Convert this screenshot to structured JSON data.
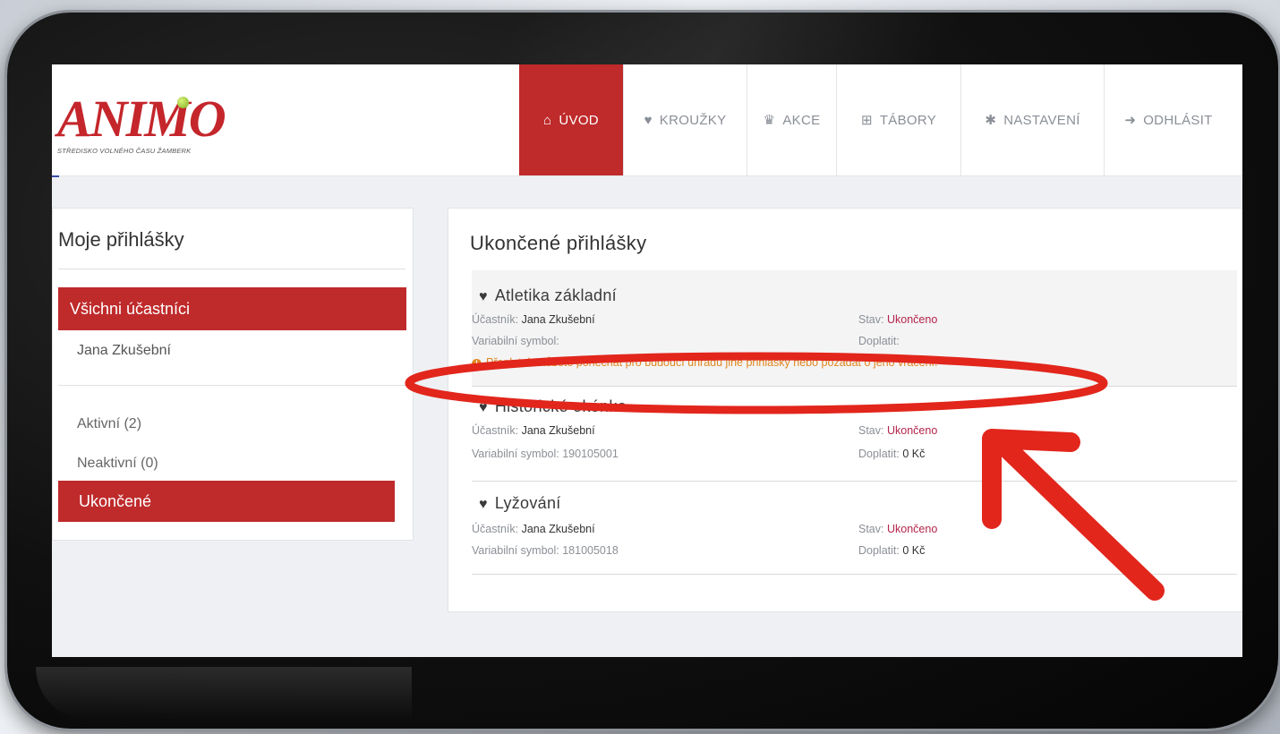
{
  "colors": {
    "accent": "#bf2a2b",
    "status": "#b4234b",
    "notice": "#e0861e",
    "annotation": "#e2261c"
  },
  "logo": {
    "word": "ANIMO",
    "subtitle": "STŘEDISKO VOLNÉHO ČASU ŽAMBERK"
  },
  "nav": [
    {
      "label": "ÚVOD",
      "icon": "home-icon",
      "glyph": "⌂",
      "active": true,
      "w": 116
    },
    {
      "label": "KROUŽKY",
      "icon": "lightbulb-icon",
      "glyph": "♥",
      "active": false,
      "w": 138
    },
    {
      "label": "AKCE",
      "icon": "trophy-icon",
      "glyph": "♛",
      "active": false,
      "w": 100
    },
    {
      "label": "TÁBORY",
      "icon": "signpost-icon",
      "glyph": "⊞",
      "active": false,
      "w": 139
    },
    {
      "label": "NASTAVENÍ",
      "icon": "gear-icon",
      "glyph": "✱",
      "active": false,
      "w": 160
    },
    {
      "label": "ODHLÁSIT",
      "icon": "logout-icon",
      "glyph": "➜",
      "active": false,
      "w": 144
    }
  ],
  "sidebar": {
    "title": "Moje přihlášky",
    "all_participants": "Všichni účastníci",
    "person": "Jana Zkušební",
    "filters": [
      "Aktivní (2)",
      "Neaktivní (0)"
    ],
    "active_filter": "Ukončené"
  },
  "content": {
    "title": "Ukončené přihlášky",
    "entries": [
      {
        "name": "Atletika základní",
        "participant_label": "Účastník:",
        "participant": "Jana Zkušební",
        "status_label": "Stav:",
        "status": "Ukončeno",
        "var_label": "Variabilní symbol:",
        "var": "",
        "pay_label": "Doplatit:",
        "pay": "",
        "notice": "Přeplatek můžete ponechat pro budoucí úhradu jiné přihlášky nebo požádat o jeho vrácení."
      },
      {
        "name": "Historické okénko",
        "participant_label": "Účastník:",
        "participant": "Jana Zkušební",
        "status_label": "Stav:",
        "status": "Ukončeno",
        "var_label": "Variabilní symbol:",
        "var": "190105001",
        "pay_label": "Doplatit:",
        "pay": "0 Kč"
      },
      {
        "name": "Lyžování",
        "participant_label": "Účastník:",
        "participant": "Jana Zkušební",
        "status_label": "Stav:",
        "status": "Ukončeno",
        "var_label": "Variabilní symbol:",
        "var": "181005018",
        "pay_label": "Doplatit:",
        "pay": "0 Kč"
      }
    ]
  }
}
